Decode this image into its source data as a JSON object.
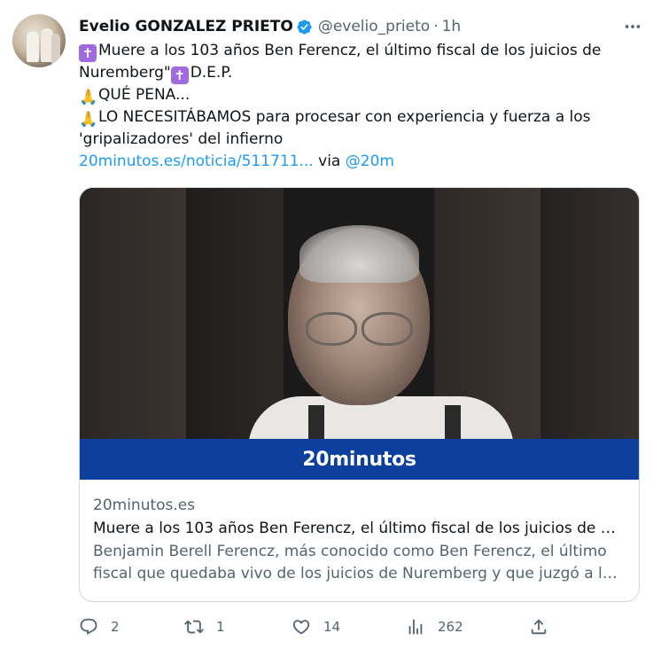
{
  "tweet": {
    "author": {
      "name": "Evelio GONZALEZ PRIETO",
      "handle": "@evelio_prieto",
      "verified": true,
      "avatar_icon": "avatar"
    },
    "separator": "·",
    "time": "1h",
    "text": {
      "line1": "Muere a los 103 años Ben Ferencz, el último fiscal de los juicios de",
      "line2_pre": "Nuremberg\"",
      "line2_post": "D.E.P.",
      "line3": "QUÉ PENA...",
      "line4": "LO NECESITÁBAMOS para procesar con experiencia y fuerza a los",
      "line5": "'gripalizadores' del infierno",
      "link": "20minutos.es/noticia/511711...",
      "via": "via",
      "mention": "@20m"
    },
    "emojis": {
      "cross": "✝",
      "pray": "🙏"
    },
    "card": {
      "image_brand": "20minutos",
      "domain": "20minutos.es",
      "title": "Muere a los 103 años Ben Ferencz, el último fiscal de los juicios de N...",
      "description_line1": "Benjamin Berell Ferencz, más conocido como Ben Ferencz, el último",
      "description_line2": "fiscal que quedaba vivo de los juicios de Nuremberg y que juzgó a lo..."
    },
    "actions": {
      "replies": "2",
      "retweets": "1",
      "likes": "14",
      "views": "262"
    }
  },
  "colors": {
    "link": "#1d9bf0",
    "secondary_text": "#536471",
    "brand_band": "#0c3f9e",
    "verified": "#1d9bf0"
  }
}
